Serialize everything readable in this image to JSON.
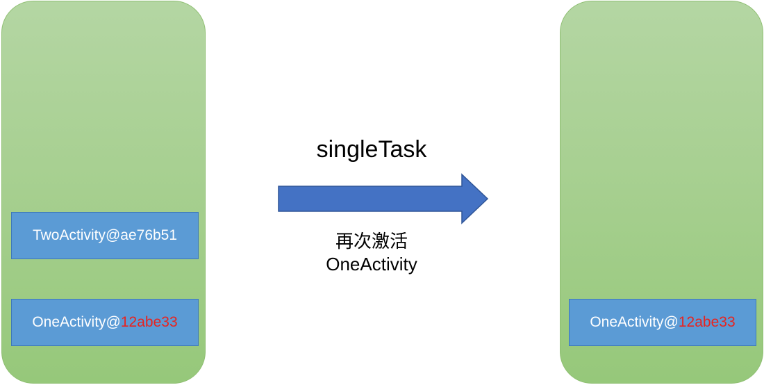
{
  "left_stack": {
    "activities": [
      {
        "name": "TwoActivity@",
        "hash": "ae76b51",
        "hash_highlight": false
      },
      {
        "name": "OneActivity@",
        "hash": "12abe33",
        "hash_highlight": true
      }
    ]
  },
  "transition": {
    "mode": "singleTask",
    "caption_line1": "再次激活",
    "caption_line2": "OneActivity"
  },
  "right_stack": {
    "activities": [
      {
        "name": "OneActivity@",
        "hash": "12abe33",
        "hash_highlight": true
      }
    ]
  },
  "colors": {
    "stack_fill": "#a6cf8f",
    "activity_fill": "#5b9bd5",
    "arrow_fill": "#4472c4",
    "hash_highlight": "#e8231f"
  }
}
